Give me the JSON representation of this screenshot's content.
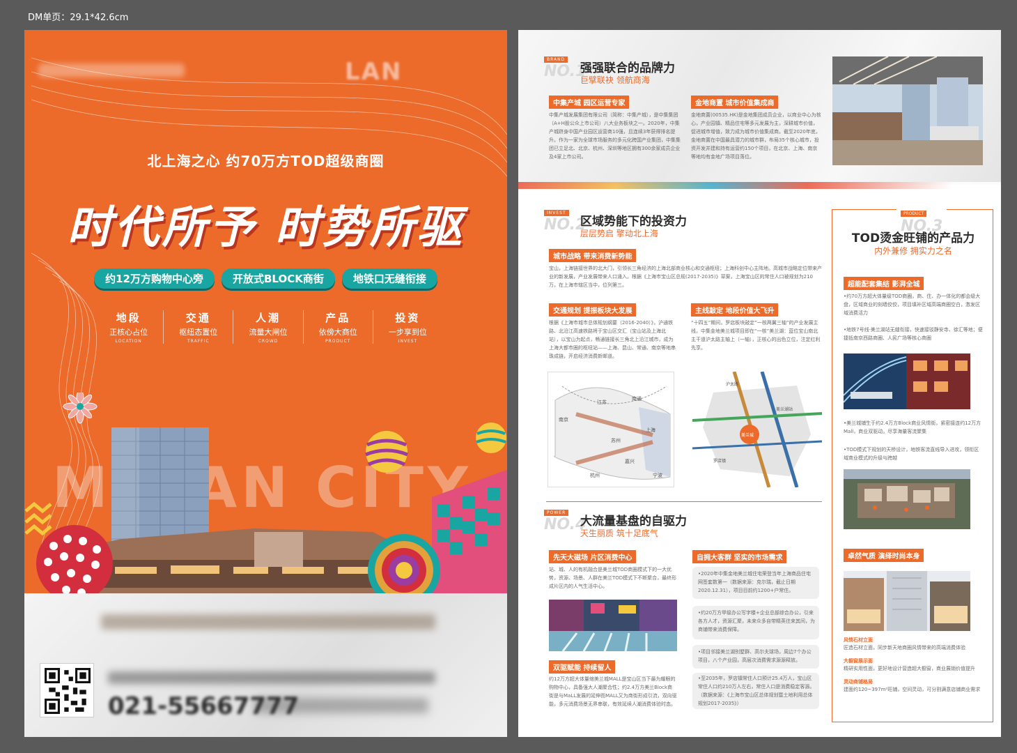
{
  "top_label": "DM单页：29.1*42.6cm",
  "front": {
    "brand_logo": "LAN",
    "subtitle": "北上海之心  约70万方TOD超级商圈",
    "headline": "时代所予  时势所驱",
    "pills": [
      "约12万方购物中心旁",
      "开放式BLOCK商街",
      "地铁口无缝衔接"
    ],
    "features": [
      {
        "title": "地段",
        "desc": "正核心占位",
        "en": "LOCATION"
      },
      {
        "title": "交通",
        "desc": "枢纽态置位",
        "en": "TRAFFIC"
      },
      {
        "title": "人潮",
        "desc": "流量大闸位",
        "en": "CROWD"
      },
      {
        "title": "产品",
        "desc": "依傍大商位",
        "en": "PRODUCT"
      },
      {
        "title": "投资",
        "desc": "一步享到位",
        "en": "INVEST"
      }
    ],
    "big_text": "MELAN CITY",
    "phone": "021-55667777",
    "colors": {
      "background": "#ec6a2a",
      "pill": "#19a5a1"
    }
  },
  "back": {
    "sec1": {
      "tag": "BRAND",
      "num": "NO.1",
      "title": "强强联合的品牌力",
      "sub": "巨擘联袂  领航商海"
    },
    "sec1_col1": {
      "tag": "中集产城  园区运营专家",
      "text": "中集产城发展集团有限公司（简称：中集产城），是中集集团（A+H股公众上市公司）八大业务板块之一。2020年，中集产城跻身中国产业园区运营商10强，且连续3年获得排名提升。作为一家为全球市场服务的多元化跨国产业集团，中集集团已立足北、北京、杭州、深圳等地区拥有300余家成员企业及4家上市公司。"
    },
    "sec1_col2": {
      "tag": "金地商置  城市价值集成商",
      "text": "金地商置(00535.HK)是金地集团成员企业，以商业中心为核心，产业园镇、精品住宅等多元发展为主，深耕城市价值，促进城市增值，致力成为城市价值集成商。截至2020年底，金地商置在中国最具潜力的城市群，布局35个核心城市，投资开发并建和持有运营约150个项目，在北京、上海、南京等地均有金地广场项目落位。"
    },
    "sec2": {
      "tag": "INVEST",
      "num": "NO.2",
      "title": "区域势能下的投资力",
      "sub": "层层势启  擎动北上海"
    },
    "sec2_a": {
      "tag": "城市战略  带来消费新势能",
      "text": "宝山，上海链接世界的北大门，引领长三角经济的上海北部商业核心和交通枢纽；上海科创中心主阵地。高城市战略定位带来产业的新发展，产业发展带来人口涌入。根据《上海市宝山区总规(2017-2035)》草案，上海宝山区的常住人口被规划为210万，在上海市辖区当中，位列第三。"
    },
    "sec2_b": {
      "tag": "交通规划  提振板块大发展",
      "text": "根据《上海市城市总体规划纲要（2016-2040）》，沪通铁路、北沿江高速铁路将于宝山区交汇（宝山站及上海北站），以宝山为起点，畅通链接长三角北上沿江城市，成为上海大都市圈的枢纽站——上海、昆山、常通、南京等地串珠成链，开启经济消费新邮道。"
    },
    "sec2_c": {
      "tag": "主线敲定  地段价值大飞升",
      "text": "“十四五”期间，罗店板块敲定“一核两翼三轴”的产业发展主线，中集金地美兰城项目即在“一核”美兰湖：蓝位宝山南北主干道沪太路主轴上（一轴），正核心的出色立位，注定红利先享。"
    },
    "sec3": {
      "tag": "POWER",
      "num": "NO.4",
      "title": "大流量基盘的自驱力",
      "sub": "天生丽质  筑十足底气"
    },
    "sec3_a": {
      "tag": "先天大磁场  片区消费中心",
      "text": "站、城、人的有机融合是美兰城TOD商圈模式下的一大优势，资源、场景、人群在美兰TOD模式下不断聚合，最终形成片区内的人气生活中心。"
    },
    "sec3_b": {
      "tag": "双驱赋能  持续留人",
      "text": "约12万方超大体量缩美兰城MALL是宝山区当下最为耀眼的购物中心，具备强大人潮聚合性；约2.4万方美兰Block商街是与MaLL发展的延伸而MALL又为商街形成引流，双向驱能，多元消费场景无界串联，有效延续人潮消费体验时态。"
    },
    "sec3_c": {
      "tag": "自拥大客群  坚实的市场需求",
      "items": [
        "•2020年中集金地美兰城住宅荣登当年上海商品住宅网签套数第一（数据来源：克尔瑞，截止日期2020.12.31），项目目前约1200+户常住。",
        "•约20万方甲级办公写字楼+企业总部综合办公，引来各方人才，资源汇聚，未来众多自带精英往来其间，为商铺带来消费保障。",
        "•项目邻接美兰湖别墅群、高尔夫球场，周边7个办公项目，八个产业园，高层次消费需求源源释放。",
        "•至2035年，罗店镇常住人口预计25.4万人，宝山区常住人口约210万人左右，常住人口是消费稳定客源。（数据来源：《上海市宝山区总体规划暨土地利用总体规划2017-2035》）"
      ]
    },
    "sec4": {
      "tag": "PRODUCT",
      "num": "NO.3",
      "title": "TOD烫金旺铺的产品力",
      "sub": "内外兼修  拥实力之名",
      "tag_a": "超能配套集结  影湃全城",
      "text_a": [
        "•约70万方超大体量级TOD商圈，商、住、办一体化的都会级大盘，区域商业的刻墙佼佼，项目填补区域高端商圈空白，激发区域消费活力",
        "•地铁7号线·美兰湖站无缝衔接，快速接驳静安寺、徐汇等地；便捷抵南京西路商圈、人民广场等核心商圈"
      ],
      "text_b": [
        "•美兰城铺生于约2.4万方Block商业风情街，紧密接连约12万方Mall，商业双驱动，尽享海量客流聚集",
        "•TOD模式下规划的天桥设计，地铁客流直线导入进攻，领衔区域商业模式的升级与跨越"
      ],
      "tag_b": "卓然气质  演绎时尚本身",
      "captions": [
        {
          "title": "风情石材立面",
          "text": "匠造石材立面，同步新天地商圈风情带来的高端消费体验"
        },
        {
          "title": "大橱窗展示面",
          "text": "精研实用性面，更好地设计营造超大橱窗，商业展销价值提升"
        },
        {
          "title": "灵动商铺格局",
          "text": "建面约120~397m²旺铺，空间灵动，可分割满意店铺商业需求"
        }
      ]
    },
    "map_labels": [
      "江苏",
      "上海",
      "嘉兴",
      "杭州",
      "南京",
      "苏州",
      "南通",
      "宁波"
    ],
    "map2_labels": [
      "美兰湖站",
      "美兰城",
      "罗店镇",
      "沪太路"
    ]
  }
}
